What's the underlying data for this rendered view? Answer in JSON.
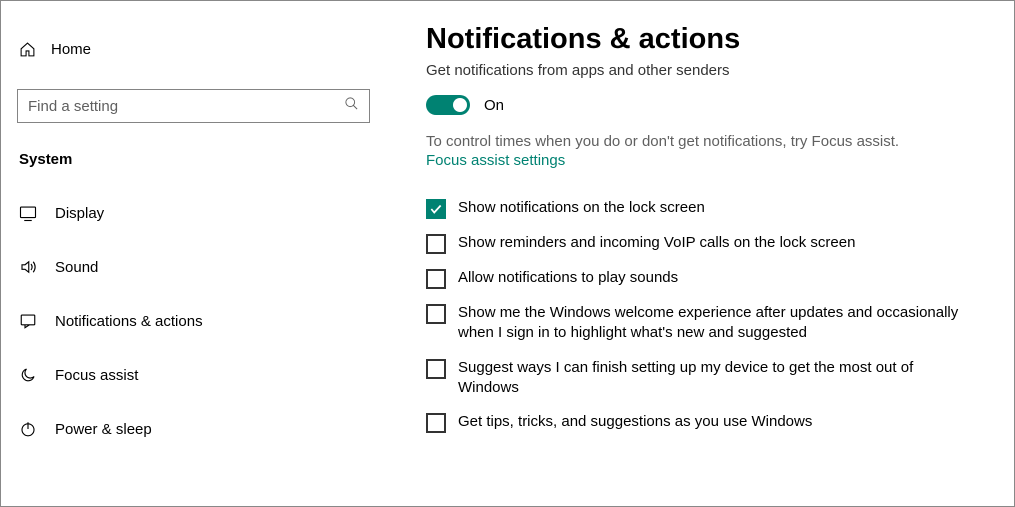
{
  "sidebar": {
    "home_label": "Home",
    "search_placeholder": "Find a setting",
    "section_label": "System",
    "items": [
      {
        "label": "Display"
      },
      {
        "label": "Sound"
      },
      {
        "label": "Notifications & actions"
      },
      {
        "label": "Focus assist"
      },
      {
        "label": "Power & sleep"
      }
    ]
  },
  "main": {
    "title": "Notifications & actions",
    "subtitle": "Get notifications from apps and other senders",
    "toggle_label": "On",
    "help_text": "To control times when you do or don't get notifications, try Focus assist.",
    "link_text": "Focus assist settings",
    "checkboxes": [
      {
        "label": "Show notifications on the lock screen",
        "checked": true
      },
      {
        "label": "Show reminders and incoming VoIP calls on the lock screen",
        "checked": false
      },
      {
        "label": "Allow notifications to play sounds",
        "checked": false
      },
      {
        "label": "Show me the Windows welcome experience after updates and occasionally when I sign in to highlight what's new and suggested",
        "checked": false
      },
      {
        "label": "Suggest ways I can finish setting up my device to get the most out of Windows",
        "checked": false
      },
      {
        "label": "Get tips, tricks, and suggestions as you use Windows",
        "checked": false
      }
    ]
  }
}
